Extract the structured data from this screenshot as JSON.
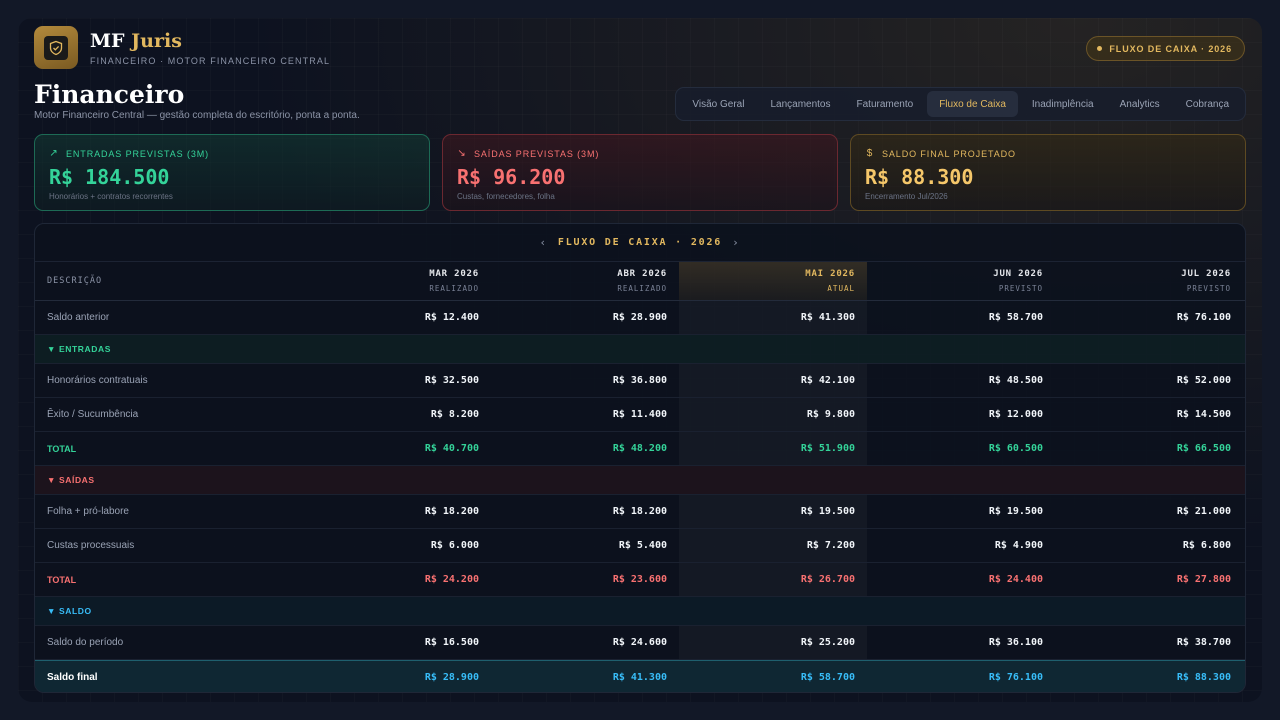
{
  "brand": {
    "name_part1": "MF",
    "name_part2": "Juris",
    "subtitle": "FINANCEIRO · MOTOR FINANCEIRO CENTRAL"
  },
  "top_pill": "FLUXO DE CAIXA · 2026",
  "page": {
    "title": "Financeiro",
    "subtitle": "Motor Financeiro Central — gestão completa do escritório, ponta a ponta."
  },
  "tabs": [
    {
      "label": "Visão Geral"
    },
    {
      "label": "Lançamentos"
    },
    {
      "label": "Faturamento"
    },
    {
      "label": "Fluxo de Caixa",
      "active": true
    },
    {
      "label": "Inadimplência"
    },
    {
      "label": "Analytics"
    },
    {
      "label": "Cobrança"
    }
  ],
  "kpis": {
    "entradas": {
      "label": "ENTRADAS PREVISTAS (3M)",
      "value": "R$ 184.500",
      "sub": "Honorários + contratos recorrentes",
      "icon": "trend-up-icon"
    },
    "saidas": {
      "label": "SAÍDAS PREVISTAS (3M)",
      "value": "R$ 96.200",
      "sub": "Custas, fornecedores, folha",
      "icon": "trend-down-icon"
    },
    "saldo": {
      "label": "SALDO FINAL PROJETADO",
      "value": "R$ 88.300",
      "sub": "Encerramento Jul/2026",
      "icon": "dollar-icon"
    }
  },
  "table": {
    "title": "FLUXO DE CAIXA · 2026",
    "prev_glyph": "‹",
    "next_glyph": "›",
    "desc_header": "DESCRIÇÃO",
    "months": [
      {
        "month": "MAR 2026",
        "status": "REALIZADO"
      },
      {
        "month": "ABR 2026",
        "status": "REALIZADO"
      },
      {
        "month": "MAI 2026",
        "status": "ATUAL"
      },
      {
        "month": "JUN 2026",
        "status": "PREVISTO"
      },
      {
        "month": "JUL 2026",
        "status": "PREVISTO"
      }
    ],
    "saldo_anterior": {
      "label": "Saldo anterior",
      "values": [
        "R$ 12.400",
        "R$ 28.900",
        "R$ 41.300",
        "R$ 58.700",
        "R$ 76.100"
      ]
    },
    "entradas": {
      "section_label": "▼ ENTRADAS",
      "rows": [
        {
          "label": "Honorários contratuais",
          "values": [
            "R$ 32.500",
            "R$ 36.800",
            "R$ 42.100",
            "R$ 48.500",
            "R$ 52.000"
          ]
        },
        {
          "label": "Êxito / Sucumbência",
          "values": [
            "R$ 8.200",
            "R$ 11.400",
            "R$ 9.800",
            "R$ 12.000",
            "R$ 14.500"
          ]
        }
      ],
      "total": {
        "label": "TOTAL",
        "values": [
          "R$ 40.700",
          "R$ 48.200",
          "R$ 51.900",
          "R$ 60.500",
          "R$ 66.500"
        ]
      }
    },
    "saidas": {
      "section_label": "▼ SAÍDAS",
      "rows": [
        {
          "label": "Folha + pró-labore",
          "values": [
            "R$ 18.200",
            "R$ 18.200",
            "R$ 19.500",
            "R$ 19.500",
            "R$ 21.000"
          ]
        },
        {
          "label": "Custas processuais",
          "values": [
            "R$ 6.000",
            "R$ 5.400",
            "R$ 7.200",
            "R$ 4.900",
            "R$ 6.800"
          ]
        }
      ],
      "total": {
        "label": "TOTAL",
        "values": [
          "R$ 24.200",
          "R$ 23.600",
          "R$ 26.700",
          "R$ 24.400",
          "R$ 27.800"
        ]
      }
    },
    "saldo": {
      "section_label": "▼ SALDO",
      "periodo": {
        "label": "Saldo do período",
        "values": [
          "R$ 16.500",
          "R$ 24.600",
          "R$ 25.200",
          "R$ 36.100",
          "R$ 38.700"
        ]
      },
      "final": {
        "label": "Saldo final",
        "values": [
          "R$ 28.900",
          "R$ 41.300",
          "R$ 58.700",
          "R$ 76.100",
          "R$ 88.300"
        ]
      }
    }
  },
  "colors": {
    "gold": "#e2b85f",
    "green": "#34d399",
    "red": "#f87171",
    "cyan": "#38bdf8",
    "background": "#0d1220"
  }
}
